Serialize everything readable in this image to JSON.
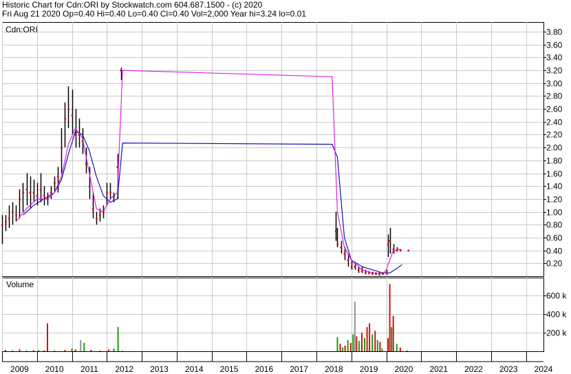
{
  "header": {
    "title": "Historic Chart for Cdn:ORI by Stockwatch.com 604.687.1500 - (c) 2020",
    "summary": "Fri Aug 21 2020  Op=0.40  Hi=0.40  Lo=0.40  Cl=0.40  Vol=2,000  Year hi=3.24  lo=0.01"
  },
  "chart_data": [
    {
      "type": "line",
      "title": "Cdn:ORI",
      "y_axis_side": "right",
      "ylim": [
        0,
        3.95
      ],
      "y_ticks": [
        "0.20",
        "0.40",
        "0.60",
        "0.80",
        "1.00",
        "1.20",
        "1.40",
        "1.60",
        "1.80",
        "2.00",
        "2.20",
        "2.40",
        "2.60",
        "2.80",
        "3.00",
        "3.20",
        "3.40",
        "3.60",
        "3.80"
      ],
      "x_ticks": [
        "2009",
        "2010",
        "2011",
        "2012",
        "2013",
        "2014",
        "2015",
        "2016",
        "2017",
        "2018",
        "2019",
        "2020",
        "2021",
        "2022",
        "2023",
        "2024"
      ],
      "grid": true,
      "colors": {
        "price": "#000000",
        "close_dots": "#cc0000",
        "ma_short": "#e020e0",
        "ma_long": "#1010c0"
      },
      "series": [
        {
          "key": "price_high_low",
          "points": [
            [
              2009.0,
              0.5,
              0.95
            ],
            [
              2009.1,
              0.7,
              0.95
            ],
            [
              2009.2,
              0.75,
              1.1
            ],
            [
              2009.3,
              0.8,
              1.15
            ],
            [
              2009.4,
              0.85,
              1.1
            ],
            [
              2009.5,
              0.9,
              1.35
            ],
            [
              2009.6,
              1.0,
              1.45
            ],
            [
              2009.7,
              1.1,
              1.6
            ],
            [
              2009.8,
              1.05,
              1.55
            ],
            [
              2009.9,
              1.15,
              1.5
            ],
            [
              2010.0,
              1.1,
              1.45
            ],
            [
              2010.1,
              1.15,
              1.6
            ],
            [
              2010.2,
              1.1,
              1.4
            ],
            [
              2010.3,
              1.1,
              1.3
            ],
            [
              2010.4,
              1.2,
              1.4
            ],
            [
              2010.5,
              1.3,
              1.55
            ],
            [
              2010.6,
              1.3,
              1.7
            ],
            [
              2010.7,
              1.6,
              2.3
            ],
            [
              2010.8,
              2.0,
              2.7
            ],
            [
              2010.9,
              2.3,
              2.95
            ],
            [
              2011.0,
              2.2,
              2.9
            ],
            [
              2011.1,
              2.0,
              2.6
            ],
            [
              2011.2,
              2.0,
              2.45
            ],
            [
              2011.3,
              1.9,
              2.3
            ],
            [
              2011.4,
              1.6,
              2.0
            ],
            [
              2011.5,
              1.2,
              1.7
            ],
            [
              2011.6,
              0.9,
              1.3
            ],
            [
              2011.7,
              0.8,
              1.0
            ],
            [
              2011.8,
              0.85,
              1.05
            ],
            [
              2011.9,
              0.9,
              1.1
            ],
            [
              2012.0,
              1.1,
              1.45
            ],
            [
              2012.1,
              1.2,
              1.45
            ],
            [
              2012.2,
              1.15,
              1.3
            ],
            [
              2012.3,
              1.2,
              1.9
            ],
            [
              2012.4,
              3.05,
              3.24
            ]
          ]
        },
        {
          "key": "price_high_low_late",
          "points": [
            [
              2018.55,
              0.55,
              1.0
            ],
            [
              2018.6,
              0.45,
              0.75
            ],
            [
              2018.7,
              0.35,
              0.55
            ],
            [
              2018.8,
              0.25,
              0.45
            ],
            [
              2018.9,
              0.15,
              0.35
            ],
            [
              2019.0,
              0.1,
              0.25
            ],
            [
              2019.1,
              0.1,
              0.2
            ],
            [
              2019.2,
              0.05,
              0.15
            ],
            [
              2019.3,
              0.05,
              0.15
            ],
            [
              2019.4,
              0.03,
              0.1
            ],
            [
              2019.5,
              0.03,
              0.08
            ],
            [
              2019.6,
              0.02,
              0.07
            ],
            [
              2019.7,
              0.02,
              0.06
            ],
            [
              2019.8,
              0.01,
              0.06
            ],
            [
              2019.9,
              0.02,
              0.06
            ],
            [
              2020.0,
              0.02,
              0.1
            ],
            [
              2020.05,
              0.3,
              0.65
            ],
            [
              2020.1,
              0.35,
              0.75
            ],
            [
              2020.2,
              0.35,
              0.5
            ],
            [
              2020.3,
              0.4,
              0.45
            ],
            [
              2020.4,
              0.4,
              0.42
            ],
            [
              2020.63,
              0.4,
              0.4
            ]
          ]
        },
        {
          "key": "close",
          "points": [
            [
              2009.0,
              0.8
            ],
            [
              2009.1,
              0.85
            ],
            [
              2009.2,
              0.9
            ],
            [
              2009.3,
              1.0
            ],
            [
              2009.4,
              0.95
            ],
            [
              2009.5,
              1.2
            ],
            [
              2009.6,
              1.3
            ],
            [
              2009.7,
              1.35
            ],
            [
              2009.8,
              1.3
            ],
            [
              2009.9,
              1.3
            ],
            [
              2010.0,
              1.25
            ],
            [
              2010.1,
              1.35
            ],
            [
              2010.2,
              1.25
            ],
            [
              2010.3,
              1.2
            ],
            [
              2010.4,
              1.3
            ],
            [
              2010.5,
              1.45
            ],
            [
              2010.6,
              1.55
            ],
            [
              2010.7,
              2.0
            ],
            [
              2010.8,
              2.45
            ],
            [
              2010.9,
              2.6
            ],
            [
              2011.0,
              2.5
            ],
            [
              2011.1,
              2.2
            ],
            [
              2011.2,
              2.2
            ],
            [
              2011.3,
              2.1
            ],
            [
              2011.4,
              1.75
            ],
            [
              2011.5,
              1.4
            ],
            [
              2011.6,
              1.05
            ],
            [
              2011.7,
              0.9
            ],
            [
              2011.8,
              0.95
            ],
            [
              2011.9,
              1.0
            ],
            [
              2012.0,
              1.3
            ],
            [
              2012.1,
              1.3
            ],
            [
              2012.2,
              1.25
            ],
            [
              2012.3,
              1.7
            ],
            [
              2012.4,
              3.2
            ],
            [
              2018.55,
              0.7
            ],
            [
              2018.6,
              0.5
            ],
            [
              2018.7,
              0.45
            ],
            [
              2018.8,
              0.35
            ],
            [
              2018.9,
              0.25
            ],
            [
              2019.0,
              0.15
            ],
            [
              2019.1,
              0.15
            ],
            [
              2019.2,
              0.1
            ],
            [
              2019.3,
              0.08
            ],
            [
              2019.4,
              0.06
            ],
            [
              2019.5,
              0.05
            ],
            [
              2019.6,
              0.04
            ],
            [
              2019.7,
              0.04
            ],
            [
              2019.8,
              0.03
            ],
            [
              2019.9,
              0.04
            ],
            [
              2020.0,
              0.06
            ],
            [
              2020.05,
              0.5
            ],
            [
              2020.1,
              0.55
            ],
            [
              2020.2,
              0.42
            ],
            [
              2020.3,
              0.4
            ],
            [
              2020.4,
              0.4
            ],
            [
              2020.63,
              0.4
            ]
          ]
        },
        {
          "key": "ma_short",
          "points": [
            [
              2009.4,
              0.85
            ],
            [
              2009.7,
              1.05
            ],
            [
              2010.0,
              1.2
            ],
            [
              2010.3,
              1.2
            ],
            [
              2010.5,
              1.3
            ],
            [
              2010.7,
              1.55
            ],
            [
              2010.9,
              2.05
            ],
            [
              2011.1,
              2.3
            ],
            [
              2011.3,
              2.15
            ],
            [
              2011.5,
              1.6
            ],
            [
              2011.7,
              1.05
            ],
            [
              2011.9,
              1.0
            ],
            [
              2012.1,
              1.2
            ],
            [
              2012.3,
              1.3
            ],
            [
              2012.45,
              3.2
            ],
            [
              2018.45,
              3.1
            ],
            [
              2018.6,
              1.0
            ],
            [
              2018.8,
              0.45
            ],
            [
              2019.0,
              0.25
            ],
            [
              2019.3,
              0.1
            ],
            [
              2019.6,
              0.05
            ],
            [
              2019.9,
              0.04
            ],
            [
              2020.0,
              0.1
            ],
            [
              2020.2,
              0.4
            ],
            [
              2020.4,
              0.42
            ]
          ]
        },
        {
          "key": "ma_long",
          "points": [
            [
              2009.6,
              0.95
            ],
            [
              2009.9,
              1.1
            ],
            [
              2010.2,
              1.2
            ],
            [
              2010.5,
              1.3
            ],
            [
              2010.7,
              1.5
            ],
            [
              2010.9,
              1.9
            ],
            [
              2011.1,
              2.25
            ],
            [
              2011.3,
              2.2
            ],
            [
              2011.5,
              1.95
            ],
            [
              2011.7,
              1.55
            ],
            [
              2011.9,
              1.25
            ],
            [
              2012.1,
              1.15
            ],
            [
              2012.3,
              1.2
            ],
            [
              2012.45,
              2.07
            ],
            [
              2018.45,
              2.05
            ],
            [
              2018.6,
              1.85
            ],
            [
              2018.8,
              0.6
            ],
            [
              2019.0,
              0.25
            ],
            [
              2019.3,
              0.15
            ],
            [
              2019.6,
              0.1
            ],
            [
              2019.9,
              0.05
            ],
            [
              2020.1,
              0.05
            ],
            [
              2020.3,
              0.12
            ],
            [
              2020.45,
              0.18
            ]
          ]
        }
      ]
    },
    {
      "type": "bar",
      "title": "Volume",
      "y_axis_side": "right",
      "ylim": [
        0,
        760000
      ],
      "y_ticks": [
        "200 k",
        "400 k",
        "600 k"
      ],
      "colors": {
        "up": "#10a010",
        "down": "#d01010",
        "flat": "#909090"
      },
      "bars": [
        [
          2009.1,
          15000,
          "down"
        ],
        [
          2009.3,
          10000,
          "up"
        ],
        [
          2009.5,
          20000,
          "down"
        ],
        [
          2009.7,
          8000,
          "up"
        ],
        [
          2009.9,
          12000,
          "down"
        ],
        [
          2010.05,
          12000,
          "up"
        ],
        [
          2010.2,
          10000,
          "down"
        ],
        [
          2010.3,
          300000,
          "down"
        ],
        [
          2010.5,
          10000,
          "up"
        ],
        [
          2010.8,
          15000,
          "down"
        ],
        [
          2011.0,
          30000,
          "up"
        ],
        [
          2011.1,
          20000,
          "down"
        ],
        [
          2011.25,
          120000,
          "flat"
        ],
        [
          2011.35,
          90000,
          "up"
        ],
        [
          2011.55,
          15000,
          "down"
        ],
        [
          2011.8,
          10000,
          "up"
        ],
        [
          2012.05,
          20000,
          "down"
        ],
        [
          2012.2,
          30000,
          "up"
        ],
        [
          2012.32,
          260000,
          "up"
        ],
        [
          2012.45,
          10000,
          "flat"
        ],
        [
          2018.6,
          150000,
          "up"
        ],
        [
          2018.68,
          80000,
          "down"
        ],
        [
          2018.75,
          40000,
          "up"
        ],
        [
          2018.82,
          60000,
          "down"
        ],
        [
          2018.9,
          120000,
          "up"
        ],
        [
          2018.98,
          90000,
          "down"
        ],
        [
          2019.05,
          180000,
          "up"
        ],
        [
          2019.1,
          530000,
          "flat"
        ],
        [
          2019.15,
          160000,
          "down"
        ],
        [
          2019.22,
          110000,
          "up"
        ],
        [
          2019.3,
          200000,
          "down"
        ],
        [
          2019.38,
          140000,
          "up"
        ],
        [
          2019.45,
          260000,
          "down"
        ],
        [
          2019.52,
          300000,
          "down"
        ],
        [
          2019.6,
          180000,
          "up"
        ],
        [
          2019.68,
          220000,
          "down"
        ],
        [
          2019.75,
          120000,
          "up"
        ],
        [
          2019.82,
          100000,
          "down"
        ],
        [
          2019.88,
          30000,
          "up"
        ],
        [
          2020.05,
          140000,
          "down"
        ],
        [
          2020.1,
          720000,
          "down"
        ],
        [
          2020.15,
          260000,
          "up"
        ],
        [
          2020.2,
          380000,
          "down"
        ],
        [
          2020.3,
          80000,
          "up"
        ],
        [
          2020.4,
          40000,
          "down"
        ],
        [
          2020.6,
          10000,
          "up"
        ]
      ]
    }
  ]
}
